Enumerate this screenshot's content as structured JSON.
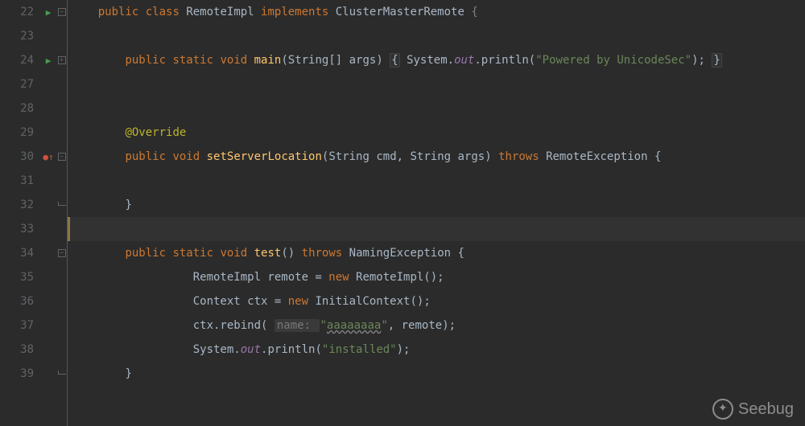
{
  "watermark": "Seebug",
  "lines": [
    {
      "n": 22,
      "run": true,
      "fold": "minus",
      "tok": [
        [
          "kw",
          "public "
        ],
        [
          "kw",
          "class "
        ],
        [
          "cls",
          "RemoteImpl "
        ],
        [
          "kw",
          "implements "
        ],
        [
          "cls",
          "ClusterMasterRemote "
        ],
        [
          "dim",
          "{"
        ]
      ],
      "indent": 1
    },
    {
      "n": 23
    },
    {
      "n": 24,
      "run": true,
      "fold": "plus",
      "tok": [
        [
          "kw",
          "public "
        ],
        [
          "kw",
          "static "
        ],
        [
          "kw",
          "void "
        ],
        [
          "fn",
          "main"
        ],
        [
          "cls",
          "(String[] args) "
        ],
        [
          "box",
          "{"
        ],
        [
          "cls",
          " System."
        ],
        [
          "field",
          "out"
        ],
        [
          "cls",
          ".println("
        ],
        [
          "str",
          "\"Powered by UnicodeSec\""
        ],
        [
          "cls",
          "); "
        ],
        [
          "box",
          "}"
        ]
      ],
      "indent": 2
    },
    {
      "n": 27
    },
    {
      "n": 28
    },
    {
      "n": 29,
      "tok": [
        [
          "ann",
          "@Override"
        ]
      ],
      "indent": 2
    },
    {
      "n": 30,
      "err": true,
      "up": true,
      "fold": "minus",
      "tok": [
        [
          "kw",
          "public "
        ],
        [
          "kw",
          "void "
        ],
        [
          "fn",
          "setServerLocation"
        ],
        [
          "cls",
          "(String cmd, String args) "
        ],
        [
          "kw",
          "throws "
        ],
        [
          "cls",
          "RemoteException {"
        ]
      ],
      "indent": 2
    },
    {
      "n": 31
    },
    {
      "n": 32,
      "fold": "end",
      "tok": [
        [
          "cls",
          "}"
        ]
      ],
      "indent": 2
    },
    {
      "n": 33,
      "cursor": true
    },
    {
      "n": 34,
      "fold": "minus",
      "tok": [
        [
          "kw",
          "public "
        ],
        [
          "kw",
          "static "
        ],
        [
          "kw",
          "void "
        ],
        [
          "fn",
          "test"
        ],
        [
          "cls",
          "() "
        ],
        [
          "kw",
          "throws "
        ],
        [
          "cls",
          "NamingException {"
        ]
      ],
      "indent": 2
    },
    {
      "n": 35,
      "tok": [
        [
          "cls",
          "RemoteImpl remote = "
        ],
        [
          "kw",
          "new "
        ],
        [
          "cls",
          "RemoteImpl();"
        ]
      ],
      "indent": 3
    },
    {
      "n": 36,
      "tok": [
        [
          "cls",
          "Context ctx = "
        ],
        [
          "kw",
          "new "
        ],
        [
          "cls",
          "InitialContext();"
        ]
      ],
      "indent": 3
    },
    {
      "n": 37,
      "tok": [
        [
          "cls",
          "ctx.rebind( "
        ],
        [
          "hint",
          "name: "
        ],
        [
          "str",
          "\""
        ],
        [
          "wavy",
          "aaaaaaaa"
        ],
        [
          "str",
          "\""
        ],
        [
          "cls",
          ", remote);"
        ]
      ],
      "indent": 3
    },
    {
      "n": 38,
      "tok": [
        [
          "cls",
          "System."
        ],
        [
          "field",
          "out"
        ],
        [
          "cls",
          ".println("
        ],
        [
          "str",
          "\"installed\""
        ],
        [
          "cls",
          ");"
        ]
      ],
      "indent": 3
    },
    {
      "n": 39,
      "fold": "end",
      "tok": [
        [
          "cls",
          "}"
        ]
      ],
      "indent": 2
    }
  ]
}
